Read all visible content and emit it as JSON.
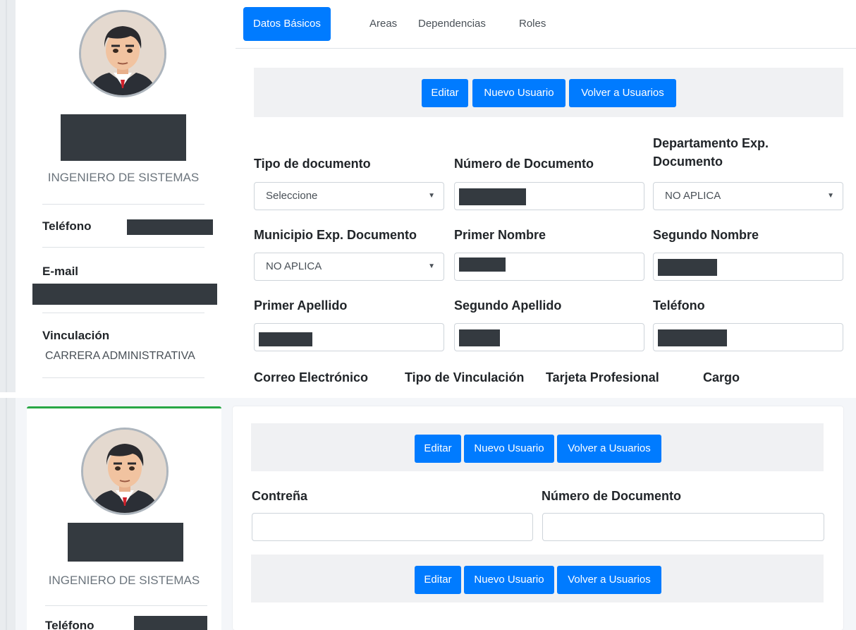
{
  "profile": {
    "job_title": "INGENIERO DE SISTEMAS",
    "phone_label": "Teléfono",
    "email_label": "E-mail",
    "link_label": "Vinculación",
    "link_value": "CARRERA ADMINISTRATIVA"
  },
  "tabs": [
    {
      "label": "Datos Básicos",
      "active": true
    },
    {
      "label": "Areas",
      "active": false
    },
    {
      "label": "Dependencias",
      "active": false
    },
    {
      "label": "Roles",
      "active": false
    }
  ],
  "actions": {
    "edit": "Editar",
    "new_user": "Nuevo Usuario",
    "back": "Volver a Usuarios"
  },
  "form": {
    "doc_type": {
      "label": "Tipo de documento",
      "value": "Seleccione"
    },
    "doc_number": {
      "label": "Número de Documento"
    },
    "dept_exp": {
      "label_line1": "Departamento Exp.",
      "label_line2": "Documento",
      "value": "NO APLICA"
    },
    "mun_exp": {
      "label": "Municipio Exp. Documento",
      "value": "NO APLICA"
    },
    "first_name": {
      "label": "Primer Nombre"
    },
    "second_name": {
      "label": "Segundo Nombre"
    },
    "first_surname": {
      "label": "Primer Apellido"
    },
    "second_surname": {
      "label": "Segundo Apellido"
    },
    "phone": {
      "label": "Teléfono"
    },
    "email": {
      "label": "Correo Electrónico"
    },
    "link_type": {
      "label": "Tipo de Vinculación"
    },
    "pro_card": {
      "label": "Tarjeta Profesional"
    },
    "position": {
      "label": "Cargo"
    }
  },
  "password_form": {
    "password": {
      "label": "Contreña",
      "value": ""
    },
    "doc_number": {
      "label": "Número de Documento",
      "value": ""
    }
  },
  "colors": {
    "accent": "#007bff",
    "card_top": "#28a745",
    "redaction": "#343a40"
  }
}
